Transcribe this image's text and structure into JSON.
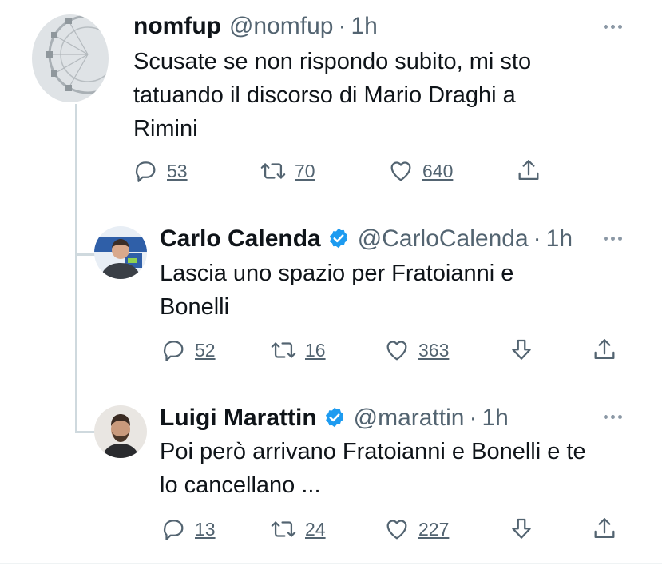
{
  "tweets": [
    {
      "name": "nomfup",
      "handle": "@nomfup",
      "separator": "·",
      "time": "1h",
      "text_lines": [
        "Scusate se non rispondo subito, mi sto",
        "tatuando il discorso di Mario Draghi a",
        "Rimini"
      ],
      "replies": "53",
      "retweets": "70",
      "likes": "640"
    },
    {
      "name": "Carlo Calenda",
      "handle": "@CarloCalenda",
      "separator": "·",
      "time": "1h",
      "text_lines": [
        "Lascia uno spazio per Fratoianni e",
        "Bonelli"
      ],
      "replies": "52",
      "retweets": "16",
      "likes": "363",
      "verified": true
    },
    {
      "name": "Luigi Marattin",
      "handle": "@marattin",
      "separator": "·",
      "time": "1h",
      "text_lines": [
        "Poi però arrivano Fratoianni e Bonelli e te",
        "lo cancellano ..."
      ],
      "replies": "13",
      "retweets": "24",
      "likes": "227",
      "verified": true
    }
  ],
  "colors": {
    "verified": "#1d9bf0",
    "muted": "#536471",
    "text": "#0f1419",
    "thread_line": "#cfd9de"
  },
  "icons": [
    "reply-icon",
    "retweet-icon",
    "like-icon",
    "download-icon",
    "share-icon",
    "more-icon",
    "verified-icon"
  ]
}
